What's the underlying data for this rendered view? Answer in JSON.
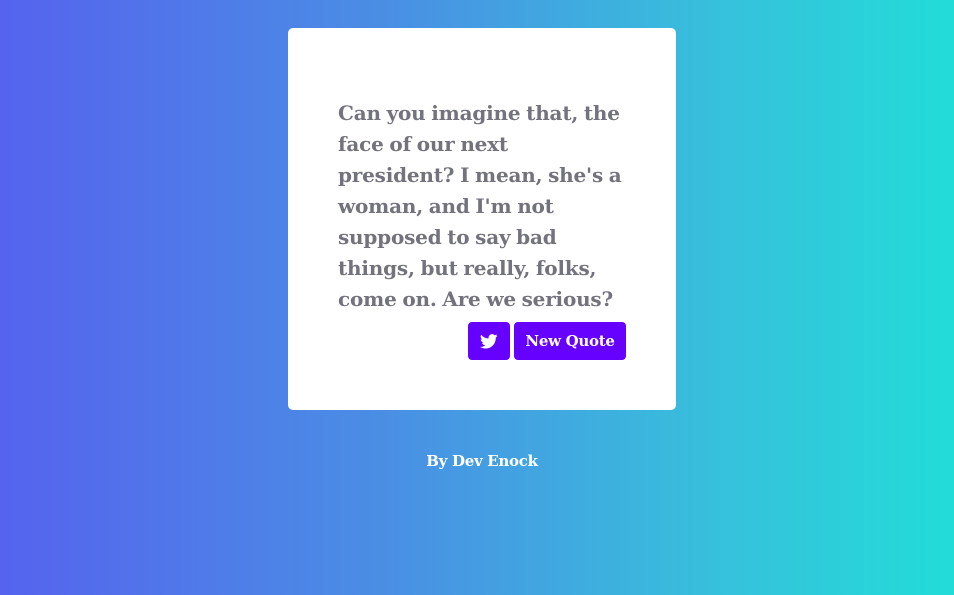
{
  "quote": {
    "text": "Can you imagine that, the face of our next president? I mean, she's a woman, and I'm not supposed to say bad things, but really, folks, come on. Are we serious?"
  },
  "actions": {
    "tweet_icon": "twitter-icon",
    "new_quote_label": "New Quote"
  },
  "footer": {
    "credit": "By Dev Enock"
  },
  "colors": {
    "button": "#6600ff",
    "quote_text": "#72737d",
    "gradient_start": "#5563ee",
    "gradient_end": "#22dcd8"
  }
}
